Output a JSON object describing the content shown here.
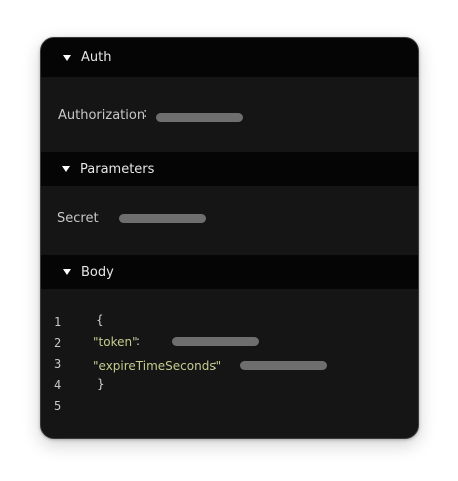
{
  "sections": {
    "auth": {
      "title": "Auth",
      "field_label": "Authorization",
      "separator": ":"
    },
    "params": {
      "title": "Parameters",
      "field_label": "Secret"
    },
    "body": {
      "title": "Body",
      "line_numbers": [
        "1",
        "2",
        "3",
        "4",
        "5"
      ],
      "open_brace": "{",
      "close_brace": "}",
      "key_token": "\"token\"",
      "key_expire": "\"expireTimeSeconds\"",
      "colon": ":"
    }
  },
  "colors": {
    "background": "#151515",
    "header": "#050505",
    "placeholder": "#6e6e6e",
    "json_key": "#c5cc8e"
  }
}
